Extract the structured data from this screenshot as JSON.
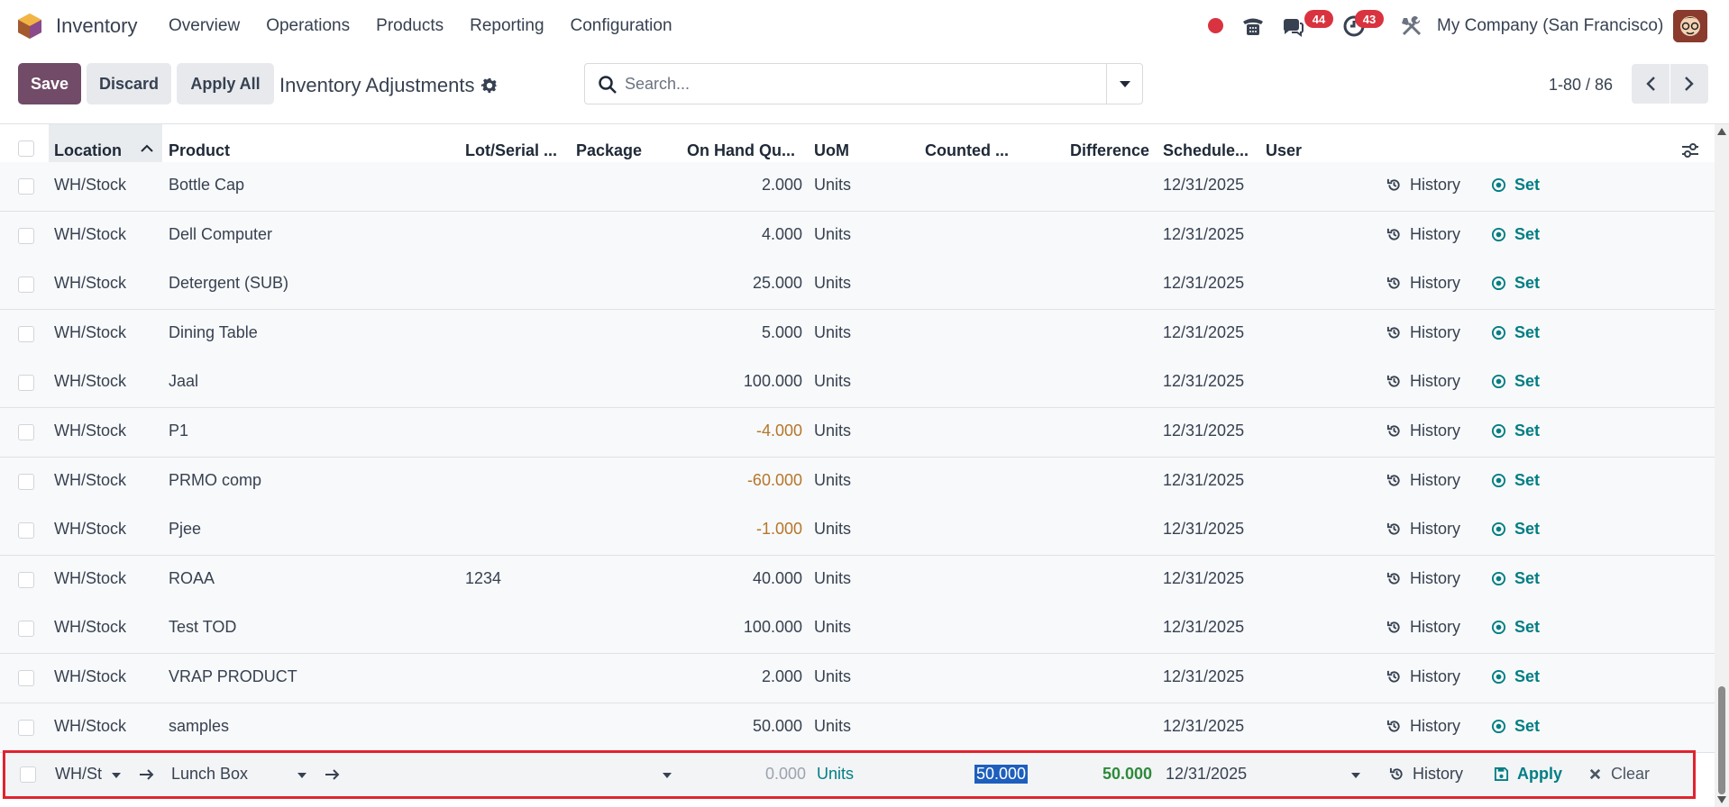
{
  "nav": {
    "app_title": "Inventory",
    "menu": [
      "Overview",
      "Operations",
      "Products",
      "Reporting",
      "Configuration"
    ],
    "messages_count": "44",
    "activities_count": "43",
    "company": "My Company (San Francisco)"
  },
  "control": {
    "save_label": "Save",
    "discard_label": "Discard",
    "apply_all_label": "Apply All",
    "page_title": "Inventory Adjustments",
    "search_placeholder": "Search...",
    "pager": "1-80 / 86"
  },
  "table": {
    "headers": {
      "location": "Location",
      "product": "Product",
      "lot": "Lot/Serial ...",
      "package": "Package",
      "on_hand": "On Hand Qu...",
      "uom": "UoM",
      "counted": "Counted ...",
      "difference": "Difference",
      "scheduled": "Schedule...",
      "user": "User"
    },
    "history_label": "History",
    "set_label": "Set",
    "rows": [
      {
        "location": "WH/Stock",
        "product": "Bottle Cap",
        "lot": "",
        "on_hand": "2.000",
        "uom": "Units",
        "date": "12/31/2025",
        "negative": false
      },
      {
        "location": "WH/Stock",
        "product": "Dell Computer",
        "lot": "",
        "on_hand": "4.000",
        "uom": "Units",
        "date": "12/31/2025",
        "negative": false
      },
      {
        "location": "WH/Stock",
        "product": "Detergent (SUB)",
        "lot": "",
        "on_hand": "25.000",
        "uom": "Units",
        "date": "12/31/2025",
        "negative": false
      },
      {
        "location": "WH/Stock",
        "product": "Dining Table",
        "lot": "",
        "on_hand": "5.000",
        "uom": "Units",
        "date": "12/31/2025",
        "negative": false
      },
      {
        "location": "WH/Stock",
        "product": "Jaal",
        "lot": "",
        "on_hand": "100.000",
        "uom": "Units",
        "date": "12/31/2025",
        "negative": false
      },
      {
        "location": "WH/Stock",
        "product": "P1",
        "lot": "",
        "on_hand": "-4.000",
        "uom": "Units",
        "date": "12/31/2025",
        "negative": true
      },
      {
        "location": "WH/Stock",
        "product": "PRMO comp",
        "lot": "",
        "on_hand": "-60.000",
        "uom": "Units",
        "date": "12/31/2025",
        "negative": true
      },
      {
        "location": "WH/Stock",
        "product": "Pjee",
        "lot": "",
        "on_hand": "-1.000",
        "uom": "Units",
        "date": "12/31/2025",
        "negative": true
      },
      {
        "location": "WH/Stock",
        "product": "ROAA",
        "lot": "1234",
        "on_hand": "40.000",
        "uom": "Units",
        "date": "12/31/2025",
        "negative": false
      },
      {
        "location": "WH/Stock",
        "product": "Test TOD",
        "lot": "",
        "on_hand": "100.000",
        "uom": "Units",
        "date": "12/31/2025",
        "negative": false
      },
      {
        "location": "WH/Stock",
        "product": "VRAP PRODUCT",
        "lot": "",
        "on_hand": "2.000",
        "uom": "Units",
        "date": "12/31/2025",
        "negative": false
      },
      {
        "location": "WH/Stock",
        "product": "samples",
        "lot": "",
        "on_hand": "50.000",
        "uom": "Units",
        "date": "12/31/2025",
        "negative": false
      }
    ],
    "edit_row": {
      "location": "WH/St",
      "product": "Lunch Box",
      "on_hand": "0.000",
      "uom": "Units",
      "counted": "50.000",
      "difference": "50.000",
      "date": "12/31/2025",
      "history_label": "History",
      "apply_label": "Apply",
      "clear_label": "Clear"
    }
  }
}
